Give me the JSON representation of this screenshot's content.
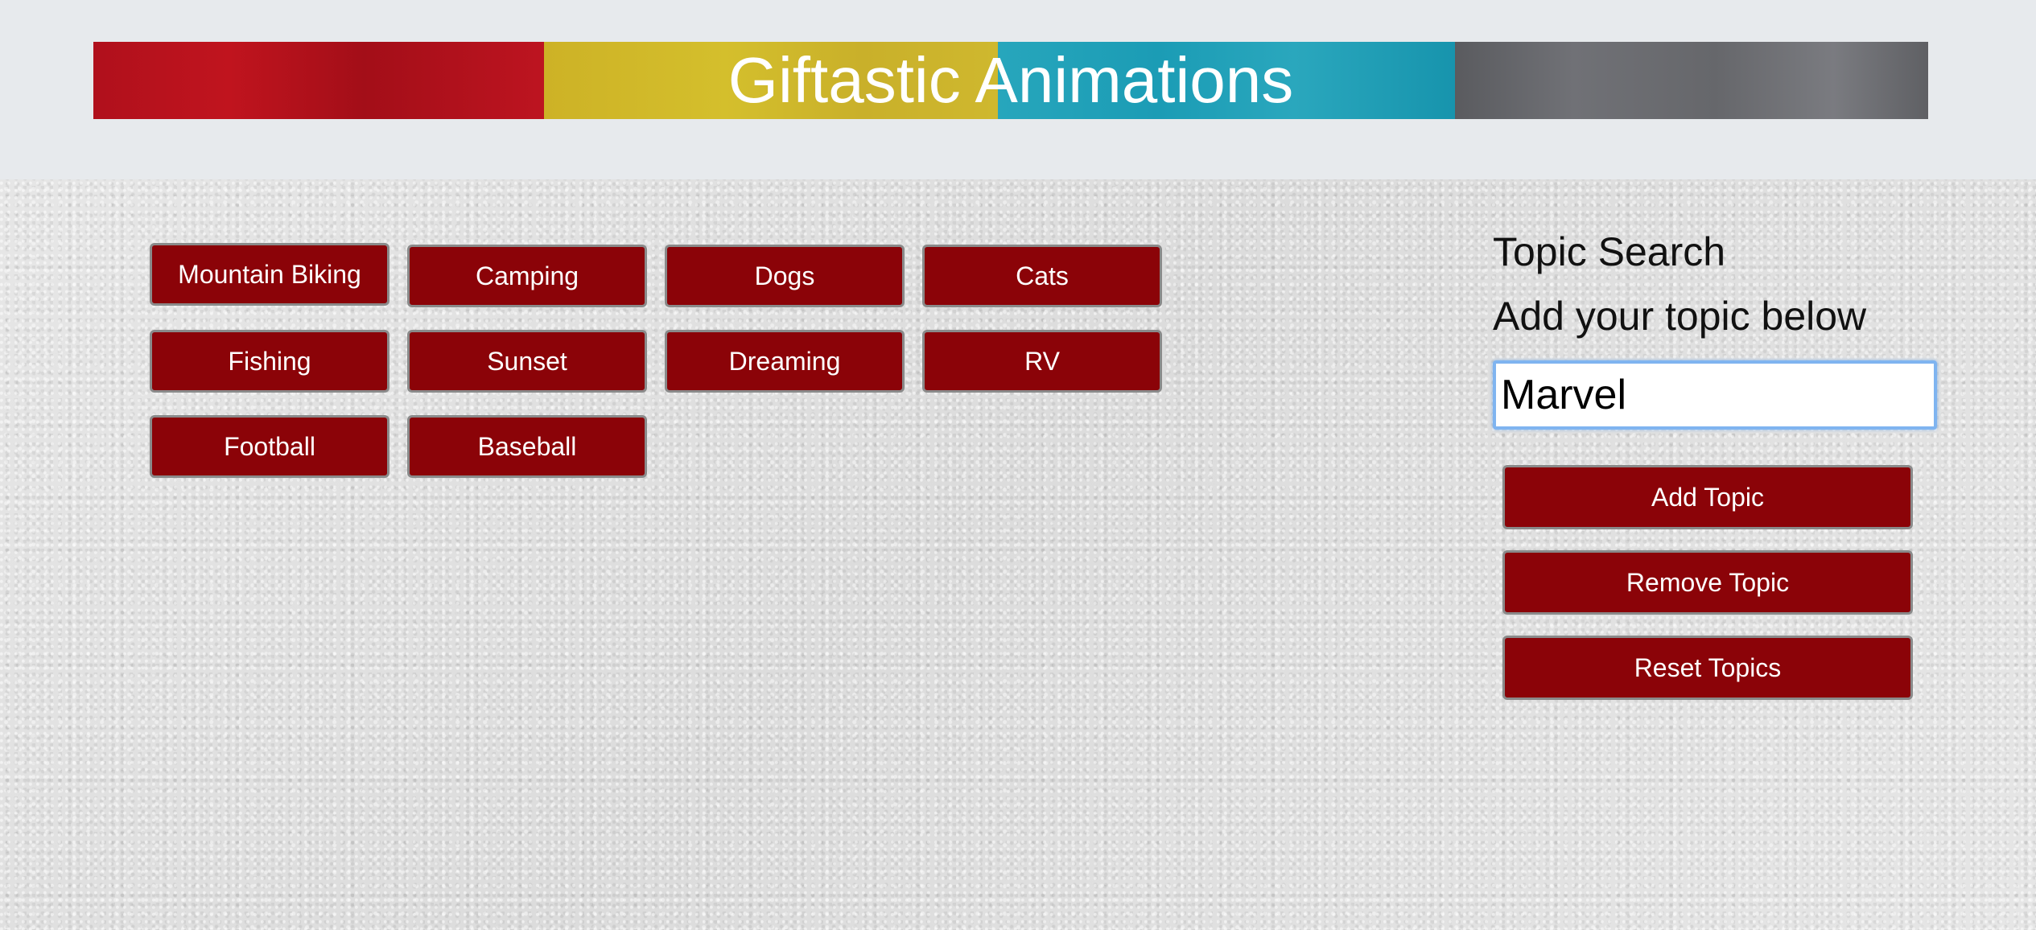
{
  "header": {
    "title": "Giftastic Animations",
    "banner_colors": [
      "#b0101c",
      "#cdb226",
      "#1b9cb5",
      "#66676b"
    ]
  },
  "topics": {
    "buttons": [
      "Mountain Biking",
      "Camping",
      "Dogs",
      "Cats",
      "Fishing",
      "Sunset",
      "Dreaming",
      "RV",
      "Football",
      "Baseball"
    ],
    "button_color": "#8b0308"
  },
  "sidebar": {
    "heading": "Topic Search",
    "subheading": "Add your topic below",
    "input_value": "Marvel",
    "add_label": "Add Topic",
    "remove_label": "Remove Topic",
    "reset_label": "Reset Topics"
  }
}
